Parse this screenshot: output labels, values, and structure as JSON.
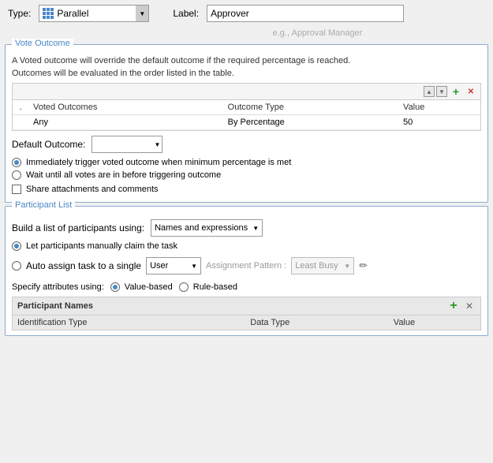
{
  "header": {
    "type_label": "Type:",
    "type_value": "Parallel",
    "label_label": "Label:",
    "label_value": "Approver",
    "label_placeholder": "e.g., Approval Manager"
  },
  "vote_outcome": {
    "section_title": "Vote Outcome",
    "desc1": "A Voted outcome will override the default outcome if the required percentage is reached.",
    "desc2": "Outcomes will be evaluated in the order listed in the table.",
    "table": {
      "dot_header": ".",
      "col1": "Voted Outcomes",
      "col2": "Outcome Type",
      "col3": "Value",
      "rows": [
        {
          "voted_outcome": "Any",
          "outcome_type": "By Percentage",
          "value": "50"
        }
      ]
    },
    "default_outcome_label": "Default Outcome:",
    "radio1": "Immediately trigger voted outcome when minimum percentage is met",
    "radio2": "Wait until all votes are in before triggering outcome",
    "checkbox": "Share attachments and comments"
  },
  "participant_list": {
    "section_title": "Participant List",
    "build_label": "Build a list of participants using:",
    "build_value": "Names and expressions",
    "radio1": "Let participants manually claim the task",
    "radio2": "Auto assign task to a single",
    "user_value": "User",
    "assignment_pattern_label": "Assignment Pattern :",
    "assignment_pattern_value": "Least Busy",
    "specify_label": "Specify attributes using:",
    "radio_value_based": "Value-based",
    "radio_rule_based": "Rule-based",
    "table_title": "Participant Names",
    "col1": "Identification Type",
    "col2": "Data Type",
    "col3": "Value"
  },
  "icons": {
    "up_arrow": "▲",
    "down_arrow": "▼",
    "add": "+",
    "remove": "✕",
    "edit": "✏",
    "dropdown": "▼"
  }
}
